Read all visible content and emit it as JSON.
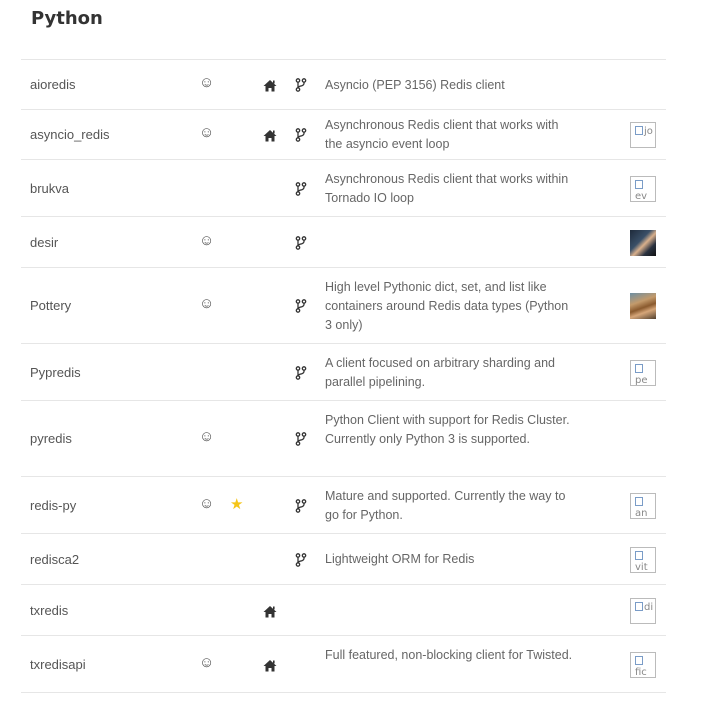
{
  "section": {
    "title": "Python"
  },
  "clients": [
    {
      "name": "aioredis",
      "recommended": true,
      "active": false,
      "home": true,
      "repo": true,
      "description": "Asyncio (PEP 3156) Redis client",
      "avatar": "none",
      "avatar_alt": ""
    },
    {
      "name": "asyncio_redis",
      "recommended": true,
      "active": false,
      "home": true,
      "repo": true,
      "description": "Asynchronous Redis client that works with the asyncio event loop",
      "avatar": "broken",
      "avatar_alt": "jo"
    },
    {
      "name": "brukva",
      "recommended": false,
      "active": false,
      "home": false,
      "repo": true,
      "description": "Asynchronous Redis client that works within Tornado IO loop",
      "avatar": "broken",
      "avatar_alt": "ev"
    },
    {
      "name": "desir",
      "recommended": true,
      "active": false,
      "home": false,
      "repo": true,
      "description": "",
      "avatar": "photo1",
      "avatar_alt": ""
    },
    {
      "name": "Pottery",
      "recommended": true,
      "active": false,
      "home": false,
      "repo": true,
      "description": "High level Pythonic dict, set, and list like containers around Redis data types (Python 3 only)",
      "avatar": "photo2",
      "avatar_alt": ""
    },
    {
      "name": "Pypredis",
      "recommended": false,
      "active": false,
      "home": false,
      "repo": true,
      "description": "A client focused on arbitrary sharding and parallel pipelining.",
      "avatar": "broken",
      "avatar_alt": "pe"
    },
    {
      "name": "pyredis",
      "recommended": true,
      "active": false,
      "home": false,
      "repo": true,
      "description": "Python Client with support for Redis Cluster. Currently only Python 3 is supported.",
      "avatar": "none",
      "avatar_alt": ""
    },
    {
      "name": "redis-py",
      "recommended": true,
      "active": true,
      "home": false,
      "repo": true,
      "description": "Mature and supported. Currently the way to go for Python.",
      "avatar": "broken",
      "avatar_alt": "an"
    },
    {
      "name": "redisca2",
      "recommended": false,
      "active": false,
      "home": false,
      "repo": true,
      "description": "Lightweight ORM for Redis",
      "avatar": "broken",
      "avatar_alt": "vit"
    },
    {
      "name": "txredis",
      "recommended": false,
      "active": false,
      "home": true,
      "repo": false,
      "description": "",
      "avatar": "broken",
      "avatar_alt": "di"
    },
    {
      "name": "txredisapi",
      "recommended": true,
      "active": false,
      "home": true,
      "repo": false,
      "description": "Full featured, non-blocking client for Twisted.",
      "avatar": "broken",
      "avatar_alt": "fic"
    }
  ],
  "icons": {
    "recommended": "smiley-icon",
    "active": "star-icon",
    "home": "home-icon",
    "repo": "fork-icon"
  },
  "colors": {
    "star": "#f5c518",
    "divider": "#e6e6e6"
  }
}
